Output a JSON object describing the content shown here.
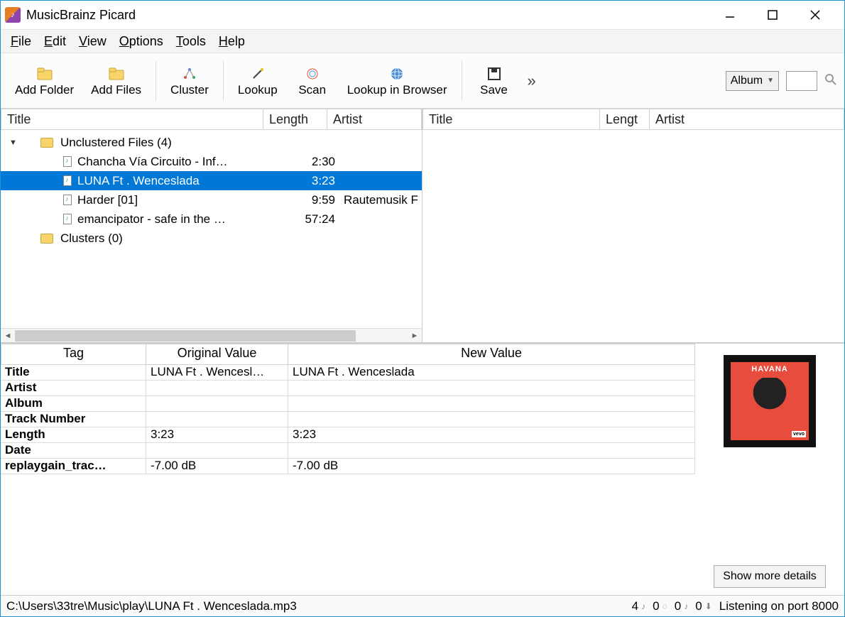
{
  "app": {
    "title": "MusicBrainz Picard"
  },
  "menus": {
    "file": "File",
    "edit": "Edit",
    "view": "View",
    "options": "Options",
    "tools": "Tools",
    "help": "Help"
  },
  "toolbar": {
    "add_folder": "Add Folder",
    "add_files": "Add Files",
    "cluster": "Cluster",
    "lookup": "Lookup",
    "scan": "Scan",
    "lookup_browser": "Lookup in Browser",
    "save": "Save",
    "search_type": "Album"
  },
  "left_pane": {
    "columns": {
      "title": "Title",
      "length": "Length",
      "artist": "Artist"
    },
    "unclustered": {
      "label": "Unclustered Files (4)",
      "files": [
        {
          "title": "Chancha Vía Circuito - Inf…",
          "length": "2:30",
          "artist": "",
          "selected": false
        },
        {
          "title": "LUNA Ft . Wenceslada",
          "length": "3:23",
          "artist": "",
          "selected": true
        },
        {
          "title": "Harder [01]",
          "length": "9:59",
          "artist": "Rautemusik F",
          "selected": false
        },
        {
          "title": "emancipator - safe in the …",
          "length": "57:24",
          "artist": "",
          "selected": false
        }
      ]
    },
    "clusters": {
      "label": "Clusters (0)"
    }
  },
  "right_pane": {
    "columns": {
      "title": "Title",
      "length": "Lengt",
      "artist": "Artist"
    }
  },
  "metadata": {
    "headers": {
      "tag": "Tag",
      "original": "Original Value",
      "newval": "New Value"
    },
    "rows": [
      {
        "tag": "Title",
        "original": "LUNA Ft . Wencesl…",
        "newval": "LUNA Ft . Wenceslada"
      },
      {
        "tag": "Artist",
        "original": "",
        "newval": ""
      },
      {
        "tag": "Album",
        "original": "",
        "newval": ""
      },
      {
        "tag": "Track Number",
        "original": "",
        "newval": ""
      },
      {
        "tag": "Length",
        "original": "3:23",
        "newval": "3:23"
      },
      {
        "tag": "Date",
        "original": "",
        "newval": ""
      },
      {
        "tag": "replaygain_trac…",
        "original": "-7.00 dB",
        "newval": "-7.00 dB"
      }
    ],
    "albumart_title": "HAVANA",
    "details_button": "Show more details"
  },
  "status": {
    "path": "C:\\Users\\33tre\\Music\\play\\LUNA Ft . Wenceslada.mp3",
    "counts": {
      "a": "4",
      "b": "0",
      "c": "0",
      "d": "0"
    },
    "listening": "Listening on port 8000"
  }
}
